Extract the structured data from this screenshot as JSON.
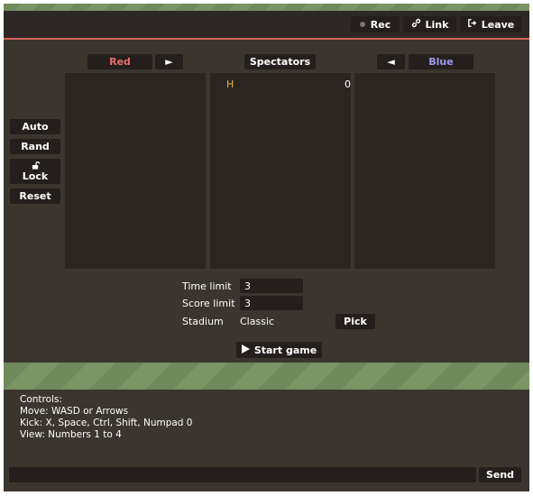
{
  "topbar": {
    "rec_label": "Rec",
    "link_label": "Link",
    "leave_label": "Leave",
    "link_icon": "link-icon",
    "leave_icon": "exit-icon",
    "rec_icon": "record-dot-icon"
  },
  "teams": {
    "red": {
      "label": "Red",
      "color": "#e5726b"
    },
    "spectators": {
      "label": "Spectators",
      "color": "#ffffff"
    },
    "blue": {
      "label": "Blue",
      "color": "#9f9bf2"
    },
    "move_right": "►",
    "move_left": "◄"
  },
  "side_buttons": {
    "auto": "Auto",
    "rand": "Rand",
    "lock": "Lock",
    "lock_icon": "unlock-icon",
    "reset": "Reset"
  },
  "spectators_list": [
    {
      "name": "H",
      "score": "0"
    }
  ],
  "settings": {
    "time_limit_label": "Time limit",
    "time_limit_value": "3",
    "score_limit_label": "Score limit",
    "score_limit_value": "3",
    "stadium_label": "Stadium",
    "stadium_value": "Classic",
    "pick_label": "Pick",
    "start_label": "Start game",
    "start_icon": "play-icon"
  },
  "chat": {
    "controls_lines": [
      "Controls:",
      "Move: WASD or Arrows",
      "Kick: X, Space, Ctrl, Shift, Numpad 0",
      "View: Numbers 1 to 4"
    ],
    "send_label": "Send"
  }
}
